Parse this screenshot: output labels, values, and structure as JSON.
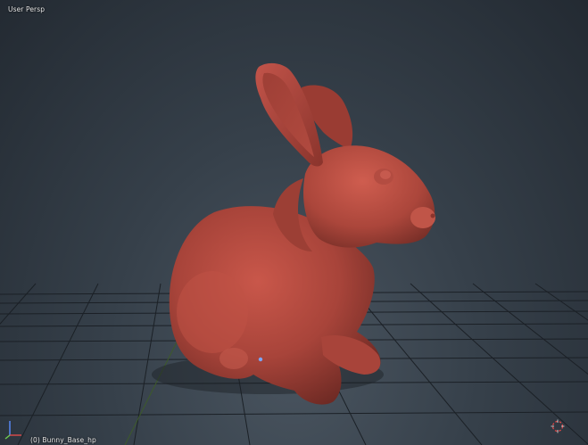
{
  "viewport": {
    "view_mode_label": "User Persp",
    "object_label": "(0) Bunny_Base_hp",
    "background_color": "#2f3841",
    "grid_color": "#1a1f24",
    "mesh_color": "#b3473a"
  },
  "icons": {
    "axis_gizmo": "axis-gizmo-icon",
    "cursor_3d": "3d-cursor-icon",
    "origin_point": "origin-dot-icon"
  }
}
